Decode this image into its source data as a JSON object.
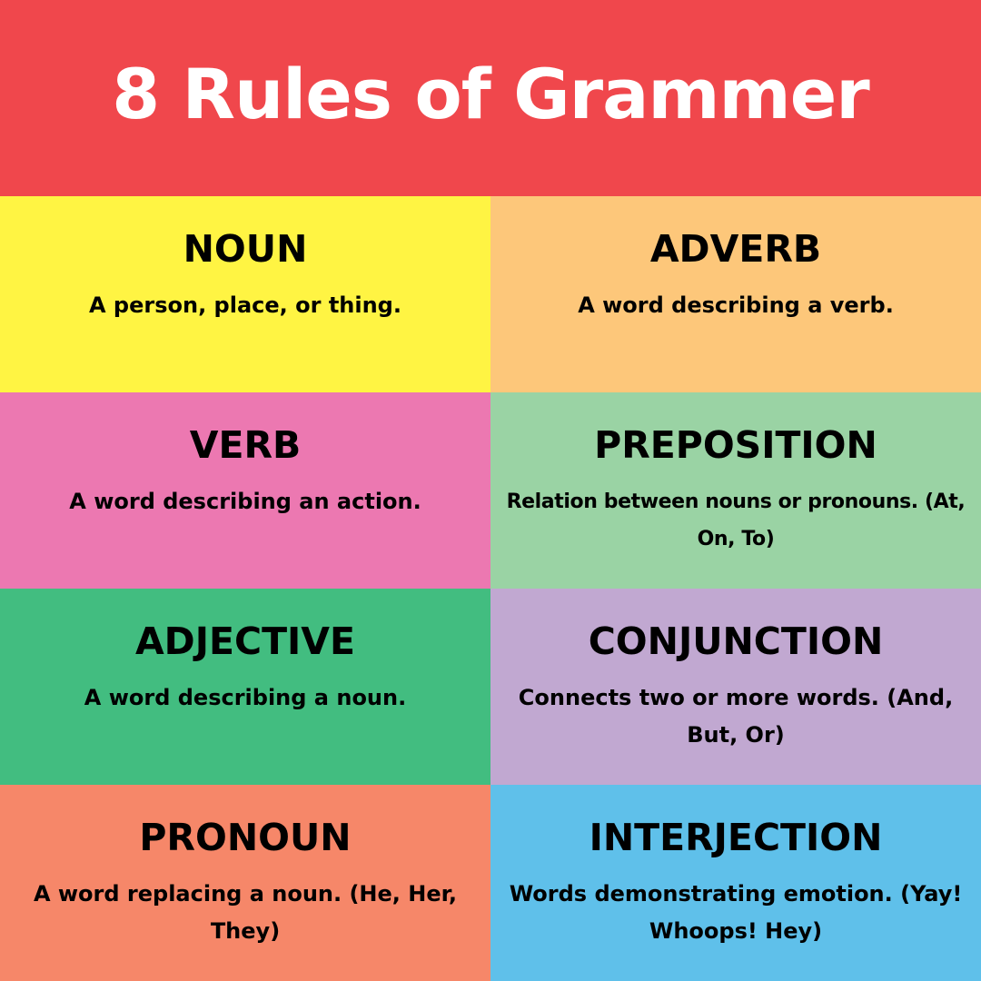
{
  "header": {
    "title": "8 Rules of Grammer",
    "background": "#f0474c"
  },
  "cells": [
    {
      "term": "NOUN",
      "definition": "A person, place, or thing.",
      "color": "#fff443"
    },
    {
      "term": "ADVERB",
      "definition": "A word describing a verb.",
      "color": "#fdc77a"
    },
    {
      "term": "VERB",
      "definition": "A word describing an action.",
      "color": "#ec78b1"
    },
    {
      "term": "PREPOSITION",
      "definition": "Relation between nouns or pronouns. (At, On, To)",
      "color": "#9ad3a4"
    },
    {
      "term": "ADJECTIVE",
      "definition": "A word describing a noun.",
      "color": "#42bd80"
    },
    {
      "term": "CONJUNCTION",
      "definition": "Connects two or more words. (And, But, Or)",
      "color": "#c1a8d1"
    },
    {
      "term": "PRONOUN",
      "definition": "A word replacing a noun. (He, Her, They)",
      "color": "#f68769"
    },
    {
      "term": "INTERJECTION",
      "definition": "Words demonstrating emotion. (Yay! Whoops! Hey)",
      "color": "#5fc0ea"
    }
  ]
}
